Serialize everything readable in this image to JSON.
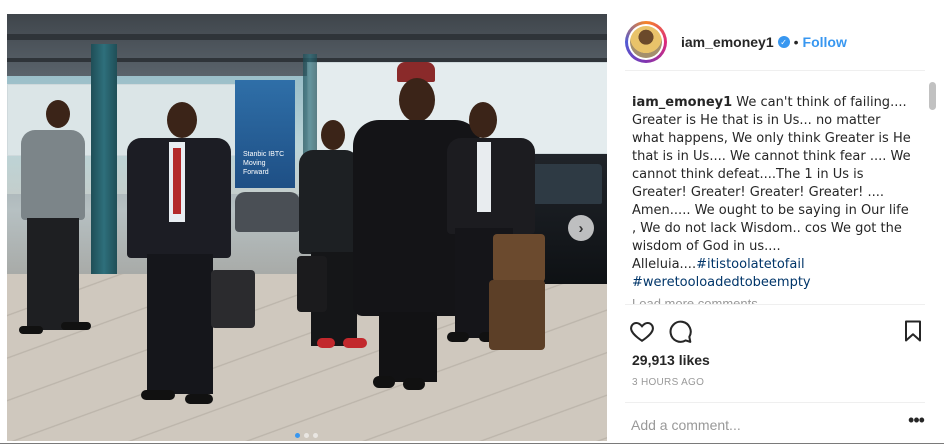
{
  "post": {
    "username": "iam_emoney1",
    "verified_badge": "✓",
    "separator": "•",
    "follow_label": "Follow",
    "caption_user": "iam_emoney1",
    "caption_text": " We can't think of failing.... Greater is He that is in Us... no matter what happens, We only think Greater is He that is in Us.... We cannot think fear .... We cannot think defeat....The 1 in Us is Greater! Greater! Greater! Greater! .... Amen..... We ought to be saying in Our life , We do not lack Wisdom.. cos We got the wisdom of God in us.... Alleluia....",
    "hashtag_1": "#itistoolatetofail",
    "hashtag_2": "#weretooloadedtobeempty",
    "load_more": "Load more comments",
    "likes": "29,913 likes",
    "timestamp": "3 HOURS AGO",
    "comment_placeholder": "Add a comment...",
    "more_glyph": "•••"
  },
  "photo": {
    "bank_sign_text": "Stanbic IBTC\nMoving Forward",
    "next_arrow": "›",
    "slide_count": 3,
    "active_slide": 1
  },
  "icons": {
    "like": "heart-icon",
    "comment": "comment-bubble-icon",
    "save": "bookmark-icon",
    "next": "chevron-right-icon",
    "more": "more-options-icon",
    "verified": "verified-badge-icon"
  },
  "colors": {
    "link": "#3897f0",
    "text": "#262626",
    "muted": "#999999",
    "hashtag": "#003569",
    "border": "#efefef"
  }
}
